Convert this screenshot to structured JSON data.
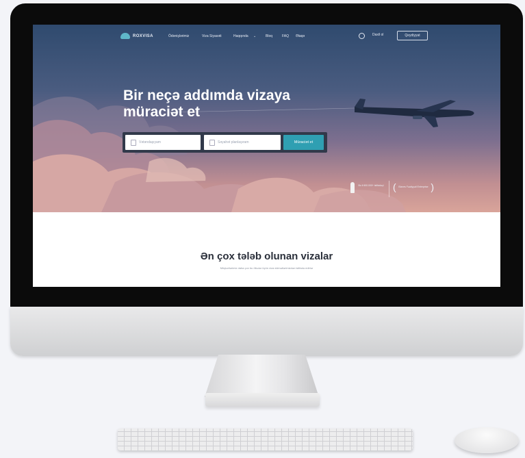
{
  "nav": {
    "logo_text": "ROXVISA",
    "links": [
      "Ödənişlərimiz",
      "Viza Siyasəti",
      "Haqqında",
      "Bloq",
      "FAQ",
      "Əlaqə"
    ],
    "login_label": "Daxil ol",
    "register_label": "Qeydiyyat"
  },
  "hero": {
    "headline_line1": "Bir neçə addımda vizaya",
    "headline_line2": "müraciət et",
    "citizenship_placeholder": "Vətəndaşıyam",
    "destination_placeholder": "Səyahət planlaşıram",
    "submit_label": "Müraciət et",
    "award1_text": "Bu il 600.000+ istifadəçi",
    "award2_text": "Biznes Fəaliyyəti Enterprise"
  },
  "section": {
    "title": "Ən çox tələb olunan vizalar",
    "subtitle": "Müştərilərimiz daha çox bu ölkələr üçün viza xidmətlərimizdən istifadə edirlər"
  },
  "colors": {
    "accent": "#2f9fb2",
    "hero_top": "#2f4a6e",
    "hero_bottom": "#d9a49a"
  }
}
